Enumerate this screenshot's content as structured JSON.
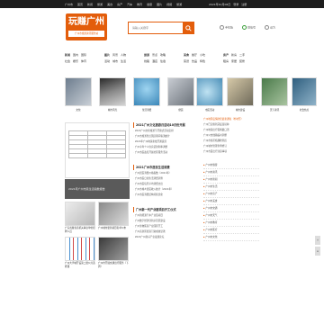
{
  "topbar": {
    "links": [
      "广州市",
      "首页",
      "新闻",
      "旅游",
      "美食",
      "房产",
      "汽车",
      "教育",
      "健康",
      "图片",
      "视频",
      "旅游"
    ],
    "date": "2021年10月06日",
    "login": "登录",
    "register": "注册"
  },
  "logo": {
    "main": "玩赚广州",
    "sub": "广州市旅游资讯服务站"
  },
  "search": {
    "placeholder": "请输入关键字"
  },
  "header_actions": [
    {
      "label": "手机版"
    },
    {
      "label": "微信号"
    },
    {
      "label": "设为"
    }
  ],
  "nav": {
    "cols": [
      {
        "hd": "新闻",
        "items": [
          "国内",
          "国际",
          "社会",
          "娱乐",
          "体育"
        ]
      },
      {
        "hd": "图片",
        "items": [
          "风景",
          "人物",
          "活动",
          "城市",
          "生活"
        ]
      },
      {
        "hd": "旅游",
        "items": [
          "景点",
          "攻略",
          "线路",
          "酒店",
          "住宿"
        ]
      },
      {
        "hd": "美食",
        "items": [
          "餐厅",
          "小吃",
          "菜谱",
          "饮品",
          "特色"
        ]
      },
      {
        "hd": "房产",
        "items": [
          "新房",
          "二手",
          "租房",
          "家居",
          "装修"
        ]
      }
    ]
  },
  "strip": [
    {
      "cap": "文化"
    },
    {
      "cap": "城市风光"
    },
    {
      "cap": "生活消费"
    },
    {
      "cap": "便民"
    },
    {
      "cap": "市民活动"
    },
    {
      "cap": "城市建设"
    },
    {
      "cap": "天下资讯"
    },
    {
      "cap": "社会热点"
    }
  ],
  "left": {
    "banner": "2021年广州市民生活指数报告",
    "pics": [
      {
        "cap": "广东省属省直机关事业单位招聘人员"
      },
      {
        "cap": "广州城市更新项目名单公布"
      },
      {
        "cap": "广州大学城开设第二批公共选修课"
      },
      {
        "cap": "广州市开展交通出行服务（下周）"
      }
    ]
  },
  "mid": {
    "sections": [
      {
        "title": "2021广州文化旅游月活动10月份开展",
        "items": [
          "2021广州文化旅游节开幕式活动安排",
          "广州市旅游景点国庆期间客流统计",
          "2021年广州地铁新线开通运营",
          "广州今年个人住房贷款利率调整",
          "广州市民政局开展社区服务活动"
        ]
      },
      {
        "title": "2021广州市居民生活消费",
        "items": [
          "广州居民消费价格指数（2021年）",
          "广州市民日常生活消费调查",
          "广州市民每月平均消费支出",
          "广州市城乡居民收入统计（2021年）",
          "广州市民消费结构持续优化"
        ]
      },
      {
        "title": "广州新一代产业链项目开工仪式",
        "items": [
          "广州新能源汽车产业链项目",
          "广州数字经济创新示范区建设",
          "广州生物医药产业园区开工",
          "广州高新区招商引资成效显著",
          "2021广州新兴产业发展论坛"
        ]
      }
    ]
  },
  "right": {
    "top": [
      "广州地区疫情防控最新通知（外地至）",
      "广州已实施新冠疫苗接种",
      "广州地铁出行需佩戴口罩",
      "广州公交线路临时调整",
      "广州市各区核酸检测点",
      "广州城市管理条例修订",
      "广州市民出行注意事项"
    ],
    "list": [
      "广州市旅游",
      "广州市资讯",
      "广州市新闻",
      "广州市生活",
      "广州市房产",
      "广州市美食",
      "广州市交通",
      "广州市天气",
      "广州市教育",
      "广州市医疗",
      "广州市文化"
    ]
  },
  "side_controls": [
    "↑",
    "⌂"
  ]
}
